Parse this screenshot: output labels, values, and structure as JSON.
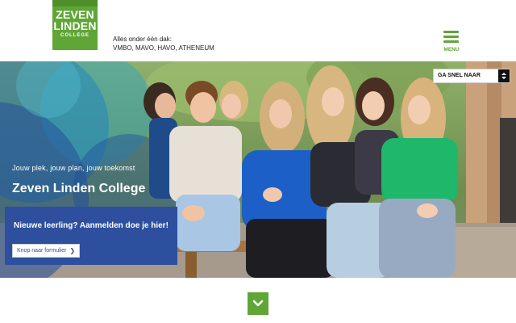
{
  "header": {
    "logo": {
      "line1": "ZEVEN",
      "line2": "LINDEN",
      "line3": "COLLEGE"
    },
    "tagline": "Alles onder één dak:",
    "levels": "VMBO, MAVO, HAVO, ATHENEUM",
    "menu_label": "MENU"
  },
  "hero": {
    "quick_nav_label": "GA SNEL NAAR",
    "subtitle": "Jouw plek, jouw plan, jouw toekomst",
    "title": "Zeven Linden College",
    "cta": {
      "text": "Nieuwe leerling? Aanmelden doe je hier!",
      "button_label": "Knop naar formulier"
    }
  },
  "icons": {
    "menu": "hamburger-icon",
    "quick_nav": "caret-updown-icon",
    "cta_button": "chevron-right-icon",
    "scroll": "chevron-down-icon"
  },
  "colors": {
    "brand_green": "#5fa636",
    "brand_blue": "#2d4f9e",
    "text_dark": "#222222"
  }
}
